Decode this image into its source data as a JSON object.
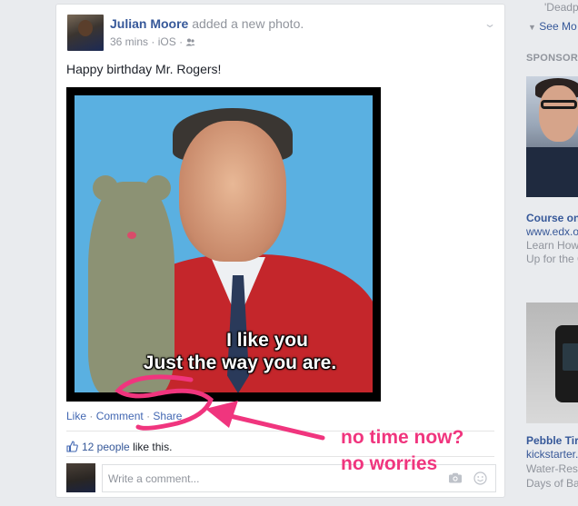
{
  "post": {
    "author": "Julian Moore",
    "action": "added a new photo.",
    "time": "36 mins",
    "platform": "iOS",
    "text": "Happy birthday Mr. Rogers!",
    "photo_caption_line1": "I like you",
    "photo_caption_line2": "Just the way you are.",
    "actions": {
      "like": "Like",
      "comment": "Comment",
      "share": "Share"
    },
    "likes": {
      "count": "12 people",
      "suffix": "like this."
    },
    "comment_placeholder": "Write a comment..."
  },
  "right_column": {
    "top_snippet": "'Deadp",
    "see_more": "See Mo",
    "sponsored_label": "SPONSORE",
    "ads": [
      {
        "title": "Course on",
        "domain": "www.edx.o",
        "desc1": "Learn How",
        "desc2": "Up for the C"
      },
      {
        "title": "Pebble Tir",
        "domain": "kickstarter.",
        "desc1": "Water-Res",
        "desc2": "Days of Ba"
      }
    ]
  },
  "annotation": {
    "line1": "no time now?",
    "line2": "no worries"
  },
  "colors": {
    "link_blue": "#365899",
    "annotation_pink": "#f0357e",
    "page_bg": "#e9ebee"
  }
}
